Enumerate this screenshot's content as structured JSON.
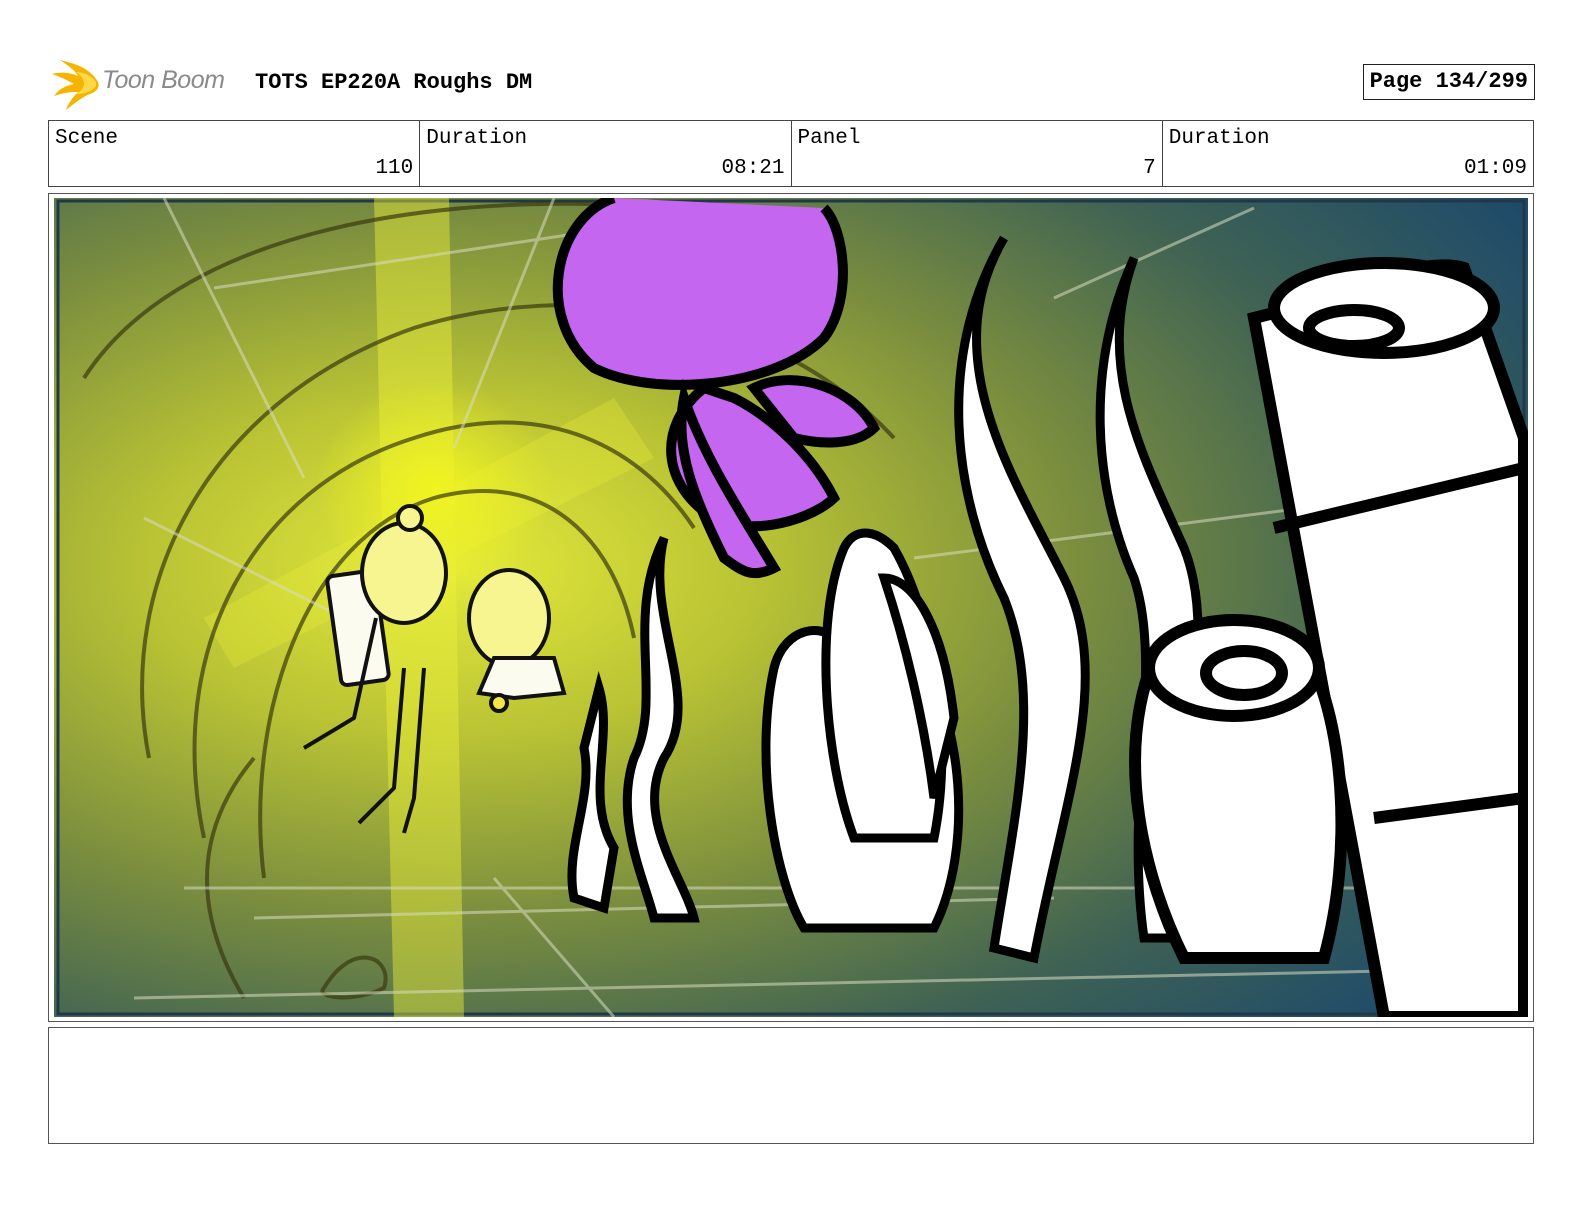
{
  "header": {
    "brand": "Toon Boom",
    "title": "TOTS EP220A Roughs DM",
    "page": "Page 134/299"
  },
  "info": [
    {
      "label": "Scene",
      "value": "110"
    },
    {
      "label": "Duration",
      "value": "08:21"
    },
    {
      "label": "Panel",
      "value": "7"
    },
    {
      "label": "Duration",
      "value": "01:09"
    }
  ],
  "colors": {
    "logo_flame": "#f5b400",
    "jellyfish": "#c466f0",
    "light_beam": "#e6ec1a",
    "water_deep": "#1e4a6a"
  },
  "notes": ""
}
